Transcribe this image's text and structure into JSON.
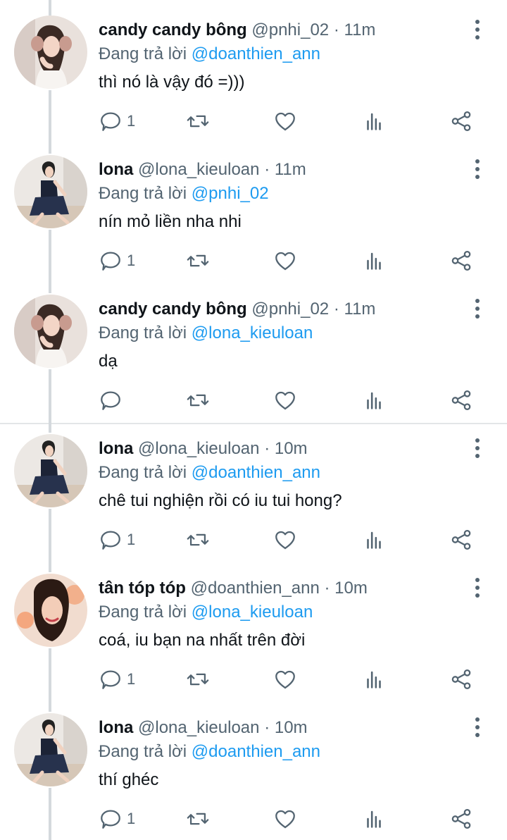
{
  "tweets": [
    {
      "name": "candy candy bông",
      "handle": "@pnhi_02",
      "separator": "·",
      "time": "11m",
      "reply_prefix": "Đang trả lời",
      "reply_to": "@doanthien_ann",
      "text": "thì nó là vậy đó =)))",
      "reply_count": "1",
      "avatar_icon": "avatar-candy"
    },
    {
      "name": "lona",
      "handle": "@lona_kieuloan",
      "separator": "·",
      "time": "11m",
      "reply_prefix": "Đang trả lời",
      "reply_to": "@pnhi_02",
      "text": "nín mỏ liền nha nhi",
      "reply_count": "1",
      "avatar_icon": "avatar-lona"
    },
    {
      "name": "candy candy bông",
      "handle": "@pnhi_02",
      "separator": "·",
      "time": "11m",
      "reply_prefix": "Đang trả lời",
      "reply_to": "@lona_kieuloan",
      "text": "dạ",
      "reply_count": "",
      "avatar_icon": "avatar-candy"
    },
    {
      "name": "lona",
      "handle": "@lona_kieuloan",
      "separator": "·",
      "time": "10m",
      "reply_prefix": "Đang trả lời",
      "reply_to": "@doanthien_ann",
      "text": "chê tui nghiện rồi có iu tui hong?",
      "reply_count": "1",
      "avatar_icon": "avatar-lona"
    },
    {
      "name": "tân tóp tóp",
      "handle": "@doanthien_ann",
      "separator": "·",
      "time": "10m",
      "reply_prefix": "Đang trả lời",
      "reply_to": "@lona_kieuloan",
      "text": "coá, iu bạn na nhất trên đời",
      "reply_count": "1",
      "avatar_icon": "avatar-tan"
    },
    {
      "name": "lona",
      "handle": "@lona_kieuloan",
      "separator": "·",
      "time": "10m",
      "reply_prefix": "Đang trả lời",
      "reply_to": "@doanthien_ann",
      "text": "thí ghéc",
      "reply_count": "1",
      "avatar_icon": "avatar-lona"
    }
  ],
  "colors": {
    "text": "#0f1419",
    "secondary": "#536471",
    "link": "#1d9bf0",
    "thread_line": "#d4d9dd"
  },
  "icons": [
    "more-vertical-icon",
    "reply-icon",
    "retweet-icon",
    "like-icon",
    "views-icon",
    "share-icon"
  ]
}
